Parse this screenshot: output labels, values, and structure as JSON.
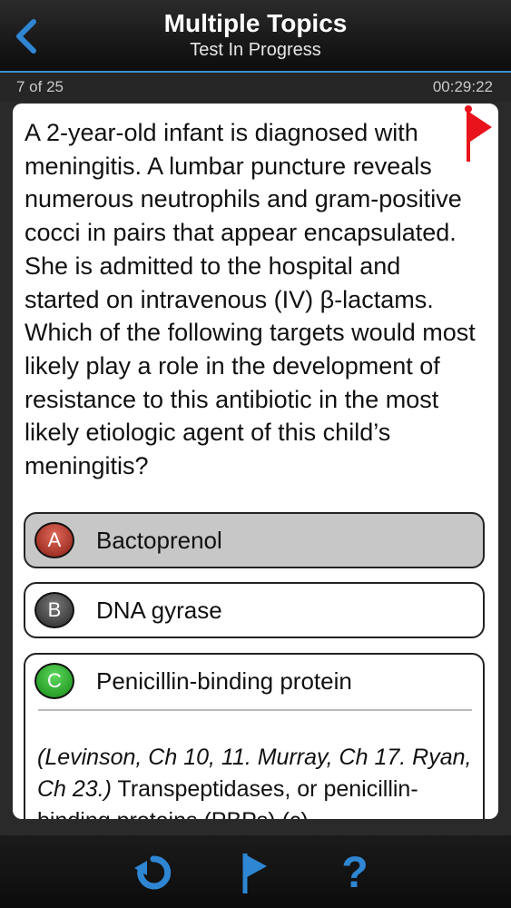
{
  "header": {
    "title": "Multiple Topics",
    "subtitle": "Test In Progress",
    "back_icon": "chevron-left-icon"
  },
  "status": {
    "progress": "7 of 25",
    "timer": "00:29:22"
  },
  "question": {
    "text": "A 2-year-old infant is diagnosed with meningitis. A lumbar puncture reveals numerous neutrophils and gram-positive cocci in pairs that appear encapsulated. She is admitted to the hospital and started on intravenous (IV) β-lactams. Which of the following targets would most likely play a role in the development of resistance to this antibiotic in the most likely etiologic agent of this child’s meningitis?",
    "flag_icon": "red-flag-icon"
  },
  "options": [
    {
      "letter": "A",
      "label": "Bactoprenol",
      "state": "selected-incorrect",
      "color": "#b32a1c"
    },
    {
      "letter": "B",
      "label": "DNA gyrase",
      "state": "unselected",
      "color": "#3a3a3a"
    },
    {
      "letter": "C",
      "label": "Penicillin-binding protein",
      "state": "correct",
      "color": "#1fa81f"
    }
  ],
  "explanation": {
    "reference": "(Levinson, Ch 10, 11. Murray, Ch 17. Ryan, Ch 23.)",
    "text": " Transpeptidases, or penicillin-binding proteins (PBPs) (c)"
  },
  "footer": {
    "reset_icon": "reset-icon",
    "flag_icon": "flag-icon",
    "help_label": "?"
  },
  "colors": {
    "accent": "#2f86d3",
    "flag": "#e8131b",
    "background": "#2a2a2a"
  }
}
